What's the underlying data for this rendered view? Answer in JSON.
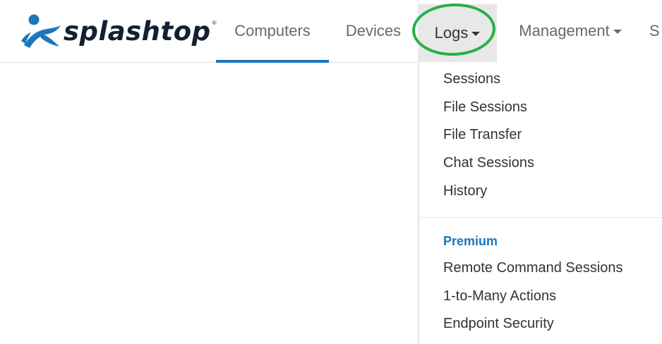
{
  "brand": {
    "name": "splashtop",
    "trademark": "®",
    "colors": {
      "logo_mark": "#1b76bc",
      "logo_text": "#142032",
      "accent": "#1b76bc",
      "annotation_circle": "#25b14a"
    }
  },
  "nav": {
    "items": [
      {
        "label": "Computers",
        "active": true
      },
      {
        "label": "Devices"
      },
      {
        "label": "Logs",
        "open": true,
        "has_caret": true
      },
      {
        "label": "Management",
        "has_caret": true
      },
      {
        "label": "S"
      }
    ]
  },
  "logs_menu": {
    "items": [
      {
        "label": "Sessions"
      },
      {
        "label": "File Sessions"
      },
      {
        "label": "File Transfer"
      },
      {
        "label": "Chat Sessions"
      },
      {
        "label": "History"
      }
    ],
    "premium": {
      "header": "Premium",
      "items": [
        {
          "label": "Remote Command Sessions"
        },
        {
          "label": "1-to-Many Actions"
        },
        {
          "label": "Endpoint Security"
        }
      ]
    }
  },
  "icons": [
    "splashtop-logo-icon",
    "caret-down-icon"
  ]
}
